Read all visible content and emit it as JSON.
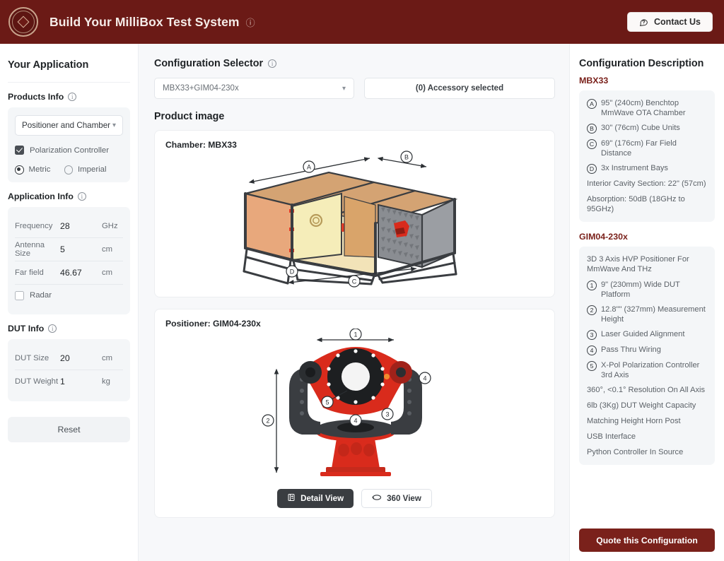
{
  "header": {
    "title": "Build Your MilliBox Test System",
    "info_icon": "info-circle-icon",
    "logo": "millibox-seal-logo",
    "contact_label": "Contact Us",
    "contact_icon": "question-bubble-icon",
    "bg_color": "#6b1a16"
  },
  "sidebar": {
    "title": "Your Application",
    "products_info": {
      "heading": "Products Info",
      "select_value": "Positioner and Chamber",
      "checkbox_label": "Polarization Controller",
      "checkbox_checked": true,
      "units": [
        {
          "label": "Metric",
          "selected": true
        },
        {
          "label": "Imperial",
          "selected": false
        }
      ]
    },
    "application_info": {
      "heading": "Application Info",
      "fields": [
        {
          "label": "Frequency",
          "value": "28",
          "unit": "GHz"
        },
        {
          "label": "Antenna Size",
          "value": "5",
          "unit": "cm"
        },
        {
          "label": "Far field",
          "value": "46.67",
          "unit": "cm"
        }
      ],
      "radar_label": "Radar",
      "radar_checked": false
    },
    "dut_info": {
      "heading": "DUT Info",
      "fields": [
        {
          "label": "DUT Size",
          "value": "20",
          "unit": "cm"
        },
        {
          "label": "DUT Weight",
          "value": "1",
          "unit": "kg"
        }
      ]
    },
    "reset_label": "Reset"
  },
  "center": {
    "selector_heading": "Configuration Selector",
    "config_value": "MBX33+GIM04-230x",
    "accessory_label": "(0) Accessory selected",
    "product_image_heading": "Product image",
    "chamber_card_title": "Chamber: MBX33",
    "chamber_dims": [
      "A",
      "B",
      "C",
      "D"
    ],
    "positioner_card_title": "Positioner: GIM04-230x",
    "positioner_dims": [
      "1",
      "2",
      "3",
      "4",
      "5"
    ],
    "detail_view_label": "Detail View",
    "detail_view_icon": "document-view-icon",
    "view360_label": "360 View",
    "view360_icon": "rotate-360-icon"
  },
  "right": {
    "title": "Configuration Description",
    "products": [
      {
        "name": "MBX33",
        "bullets": [
          {
            "badge": "A",
            "text": "95\" (240cm) Benchtop MmWave OTA Chamber"
          },
          {
            "badge": "B",
            "text": "30\" (76cm) Cube Units"
          },
          {
            "badge": "C",
            "text": "69\" (176cm) Far Field Distance"
          },
          {
            "badge": "D",
            "text": "3x Instrument Bays"
          }
        ],
        "plain": [
          "Interior Cavity Section: 22\" (57cm)",
          "Absorption: 50dB (18GHz to 95GHz)"
        ]
      },
      {
        "name": "GIM04-230x",
        "intro": "3D 3 Axis HVP Positioner For MmWave And THz",
        "bullets": [
          {
            "badge": "1",
            "text": "9\" (230mm) Wide DUT Platform"
          },
          {
            "badge": "2",
            "text": "12.8\"\" (327mm) Measurement Height"
          },
          {
            "badge": "3",
            "text": "Laser Guided Alignment"
          },
          {
            "badge": "4",
            "text": "Pass Thru Wiring"
          },
          {
            "badge": "5",
            "text": "X-Pol Polarization Controller 3rd Axis"
          }
        ],
        "plain": [
          "360°, <0.1° Resolution On All Axis",
          "6lb (3Kg) DUT Weight Capacity",
          "Matching Height Horn Post",
          "USB Interface",
          "Python Controller In Source"
        ]
      }
    ],
    "quote_label": "Quote this Configuration",
    "quote_color": "#7a211b"
  }
}
